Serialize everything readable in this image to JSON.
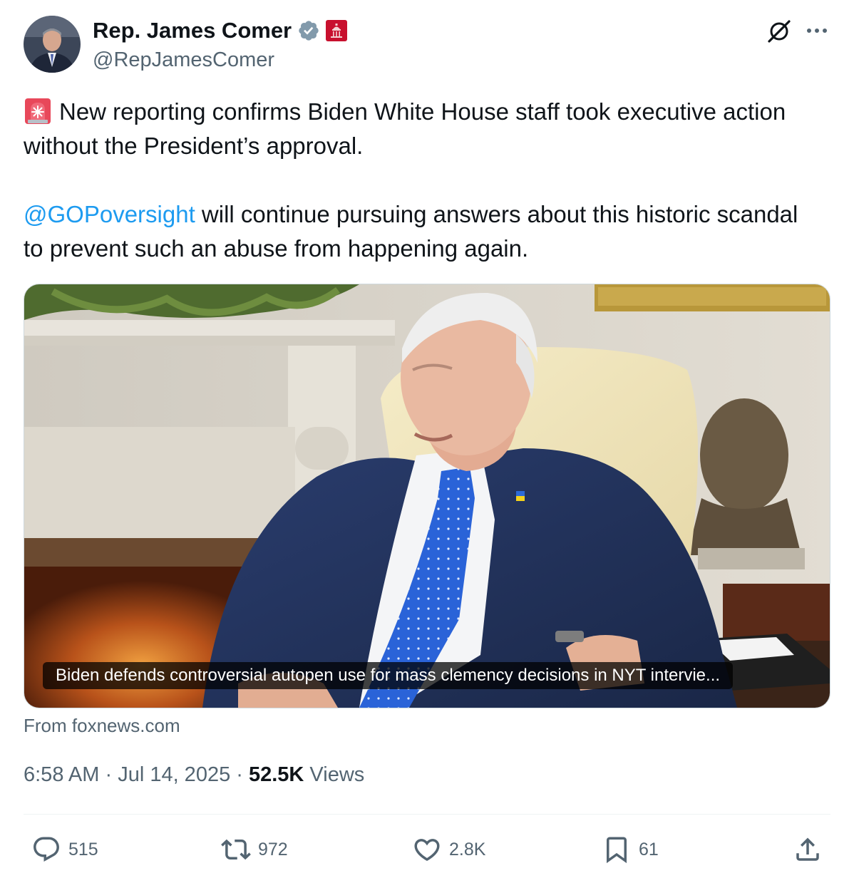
{
  "author": {
    "display_name": "Rep. James Comer",
    "handle": "@RepJamesComer"
  },
  "tweet": {
    "paragraph1": "New reporting confirms Biden White House staff took executive action without the President’s approval.",
    "mention": "@GOPoversight",
    "paragraph2_rest": " will continue pursuing answers about this historic scandal to prevent such an abuse from happening again."
  },
  "card": {
    "caption": "Biden defends controversial autopen use for mass clemency decisions in NYT intervie...",
    "source": "From foxnews.com"
  },
  "meta": {
    "time": "6:58 AM",
    "separator": " · ",
    "date": "Jul 14, 2025",
    "views_count": "52.5K",
    "views_label": " Views"
  },
  "actions": {
    "replies": "515",
    "reposts": "972",
    "likes": "2.8K",
    "bookmarks": "61"
  },
  "colors": {
    "link": "#1d9bf0",
    "secondary_text": "#536471",
    "verified": "#829aab"
  }
}
